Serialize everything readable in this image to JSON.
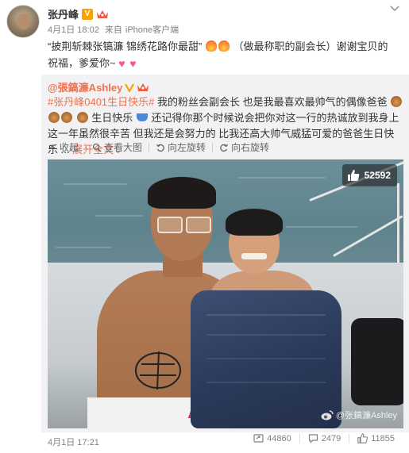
{
  "post": {
    "author": "张丹峰",
    "verified_badge": "V",
    "crown_icon": "crown-icon",
    "timestamp": "4月1日 18:02",
    "source_prefix": "来自",
    "source": "iPhone客户端",
    "text_part1": "“披荆斩棘张镐濂  锦绣花路你最甜”",
    "text_part2": "（做最称职的副会长）谢谢宝贝的祝福，爹爱你~",
    "emojis": [
      "fire-icon",
      "fire-icon",
      "heart-icon",
      "heart-icon"
    ]
  },
  "retweet": {
    "author": "@張鎬濂Ashley",
    "hashtag": "#张丹峰0401生日快乐#",
    "text_part1": "我的粉丝会副会长 也是我最喜欢最帅气的偶像爸爸",
    "text_part2": "生日快乐",
    "text_part3": "还记得你那个时候说会把你对这一行的热诚放到我身上 这一年虽然很辛苦 但我还是会努力的 比我还高大帅气威猛可爱的爸爸生日快乐 ...",
    "expand_label": "展开全文",
    "expand_arrow": "⌄",
    "tools": {
      "collapse": "收起",
      "view_large": "查看大图",
      "rotate_left": "向左旋转",
      "rotate_right": "向右旋转"
    },
    "photo": {
      "likes": "52592",
      "watermark": "@张鎬濂Ashley"
    }
  },
  "footer": {
    "date": "4月1日 17:21",
    "forward_count": "44860",
    "comment_count": "2479",
    "like_count": "11855"
  },
  "colors": {
    "accent": "#eb7350",
    "verified": "#f7a400",
    "retweet_bg": "#f2f2f5",
    "meta_text": "#808080"
  }
}
